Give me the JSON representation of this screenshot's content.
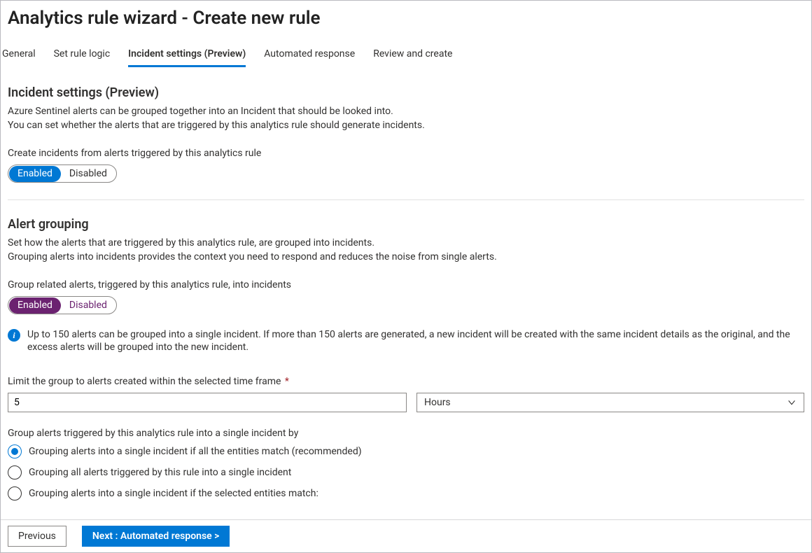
{
  "header": {
    "title": "Analytics rule wizard - Create new rule"
  },
  "tabs": [
    {
      "label": "General",
      "active": false
    },
    {
      "label": "Set rule logic",
      "active": false
    },
    {
      "label": "Incident settings (Preview)",
      "active": true
    },
    {
      "label": "Automated response",
      "active": false
    },
    {
      "label": "Review and create",
      "active": false
    }
  ],
  "incident_settings": {
    "title": "Incident settings (Preview)",
    "desc_line1": "Azure Sentinel alerts can be grouped together into an Incident that should be looked into.",
    "desc_line2": "You can set whether the alerts that are triggered by this analytics rule should generate incidents.",
    "create_incidents_label": "Create incidents from alerts triggered by this analytics rule",
    "toggle": {
      "on": "Enabled",
      "off": "Disabled",
      "value": "Enabled"
    }
  },
  "alert_grouping": {
    "title": "Alert grouping",
    "desc_line1": "Set how the alerts that are triggered by this analytics rule, are grouped into incidents.",
    "desc_line2": "Grouping alerts into incidents provides the context you need to respond and reduces the noise from single alerts.",
    "group_related_label": "Group related alerts, triggered by this analytics rule, into incidents",
    "toggle": {
      "on": "Enabled",
      "off": "Disabled",
      "value": "Enabled"
    },
    "info_text": "Up to 150 alerts can be grouped into a single incident. If more than 150 alerts are generated, a new incident will be created with the same incident details as the original, and the excess alerts will be grouped into the new incident.",
    "timeframe_label": "Limit the group to alerts created within the selected time frame",
    "timeframe_value": "5",
    "timeframe_unit": "Hours",
    "group_by_label": "Group alerts triggered by this analytics rule into a single incident by",
    "group_by_options": [
      {
        "label": "Grouping alerts into a single incident if all the entities match (recommended)",
        "selected": true
      },
      {
        "label": "Grouping all alerts triggered by this rule into a single incident",
        "selected": false
      },
      {
        "label": "Grouping alerts into a single incident if the selected entities match:",
        "selected": false
      }
    ]
  },
  "footer": {
    "previous": "Previous",
    "next": "Next : Automated response >"
  }
}
